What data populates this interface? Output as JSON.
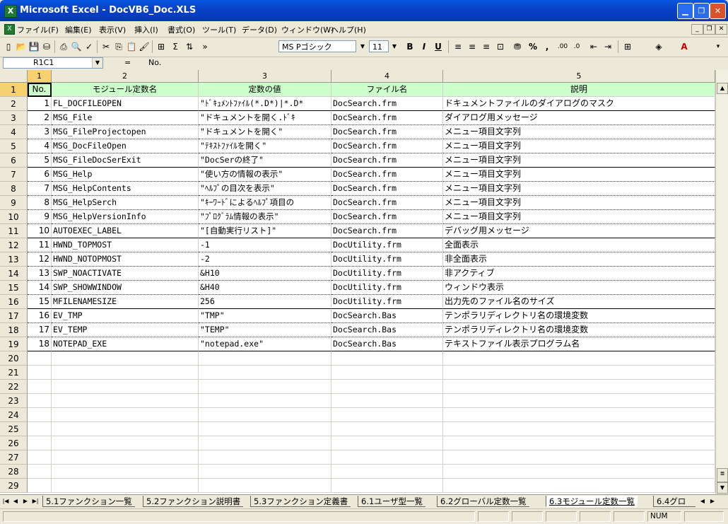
{
  "window": {
    "title": "Microsoft Excel - DocVB6_Doc.XLS",
    "app_icon_text": "X"
  },
  "menu": {
    "items": [
      "ファイル(F)",
      "編集(E)",
      "表示(V)",
      "挿入(I)",
      "書式(O)",
      "ツール(T)",
      "データ(D)",
      "ウィンドウ(W)",
      "ヘルプ(H)"
    ]
  },
  "toolbar": {
    "font_name": "MS Pゴシック",
    "font_size": "11"
  },
  "formula_bar": {
    "name_box": "R1C1",
    "equals": "=",
    "content": "No."
  },
  "grid": {
    "column_headers": [
      "1",
      "2",
      "3",
      "4",
      "5"
    ],
    "header_row": [
      "No.",
      "モジュール定数名",
      "定数の値",
      "ファイル名",
      "説明"
    ],
    "rows": [
      [
        "1",
        "FL_DOCFILEOPEN",
        "\"ﾄﾞｷｭﾒﾝﾄﾌｧｲﾙ(*.D*)|*.D*",
        "DocSearch.frm",
        "ドキュメントファイルのダイアログのマスク"
      ],
      [
        "2",
        "MSG_File",
        "\"ドキュメントを開く.ﾄﾞｷ",
        "DocSearch.frm",
        "ダイアログ用メッセージ"
      ],
      [
        "3",
        "MSG_FileProjectopen",
        "\"ドキュメントを開く\"",
        "DocSearch.frm",
        "メニュー項目文字列"
      ],
      [
        "4",
        "MSG_DocFileOpen",
        "\"ﾃｷｽﾄﾌｧｲﾙを開く\"",
        "DocSearch.frm",
        "メニュー項目文字列"
      ],
      [
        "5",
        "MSG_FileDocSerExit",
        "\"DocSerの終了\"",
        "DocSearch.frm",
        "メニュー項目文字列"
      ],
      [
        "6",
        "MSG_Help",
        "\"使い方の情報の表示\"",
        "DocSearch.frm",
        "メニュー項目文字列"
      ],
      [
        "7",
        "MSG_HelpContents",
        "\"ﾍﾙﾌﾟの目次を表示\"",
        "DocSearch.frm",
        "メニュー項目文字列"
      ],
      [
        "8",
        "MSG_HelpSerch",
        "\"ｷｰﾜｰﾄﾞによるﾍﾙﾌﾟ項目の",
        "DocSearch.frm",
        "メニュー項目文字列"
      ],
      [
        "9",
        "MSG_HelpVersionInfo",
        "\"ﾌﾟﾛｸﾞﾗﾑ情報の表示\"",
        "DocSearch.frm",
        "メニュー項目文字列"
      ],
      [
        "10",
        "AUTOEXEC_LABEL",
        "\"[自動実行リスト]\"",
        "DocSearch.frm",
        "デバッグ用メッセージ"
      ],
      [
        "11",
        "HWND_TOPMOST",
        "-1",
        "DocUtility.frm",
        "全面表示"
      ],
      [
        "12",
        "HWND_NOTOPMOST",
        "-2",
        "DocUtility.frm",
        "非全面表示"
      ],
      [
        "13",
        "SWP_NOACTIVATE",
        "&H10",
        "DocUtility.frm",
        "非アクティブ"
      ],
      [
        "14",
        "SWP_SHOWWINDOW",
        "&H40",
        "DocUtility.frm",
        "ウィンドウ表示"
      ],
      [
        "15",
        "MFILENAMESIZE",
        "256",
        "DocUtility.frm",
        "出力先のファイル名のサイズ"
      ],
      [
        "16",
        "EV_TMP",
        "\"TMP\"",
        "DocSearch.Bas",
        "テンポラリディレクトリ名の環境変数"
      ],
      [
        "17",
        "EV_TEMP",
        "\"TEMP\"",
        "DocSearch.Bas",
        "テンポラリディレクトリ名の環境変数"
      ],
      [
        "18",
        "NOTEPAD_EXE",
        "\"notepad.exe\"",
        "DocSearch.Bas",
        "テキストファイル表示プログラム名"
      ]
    ],
    "row_numbers": [
      "1",
      "2",
      "3",
      "4",
      "5",
      "6",
      "7",
      "8",
      "9",
      "10",
      "11",
      "12",
      "13",
      "14",
      "15",
      "16",
      "17",
      "18",
      "19",
      "20",
      "21",
      "22",
      "23",
      "24",
      "25",
      "26",
      "27",
      "28",
      "29"
    ]
  },
  "sheet_tabs": [
    "5.1ファンクション一覧",
    "5.2ファンクション説明書",
    "5.3ファンクション定義書",
    "6.1ユーザ型一覧",
    "6.2グローバル定数一覧",
    "6.3モジュール定数一覧",
    "6.4グロ"
  ],
  "active_sheet_index": 5,
  "status": {
    "num": "NUM"
  }
}
